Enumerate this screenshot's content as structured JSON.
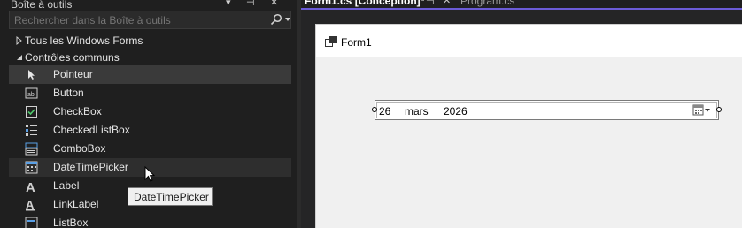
{
  "toolbox": {
    "title": "Boîte à outils",
    "search_placeholder": "Rechercher dans la Boîte à outils",
    "categories": [
      {
        "label": "Tous les Windows Forms",
        "expanded": false
      },
      {
        "label": "Contrôles communs",
        "expanded": true
      }
    ],
    "items": [
      {
        "label": "Pointeur",
        "icon": "pointer-icon"
      },
      {
        "label": "Button",
        "icon": "button-icon"
      },
      {
        "label": "CheckBox",
        "icon": "checkbox-icon"
      },
      {
        "label": "CheckedListBox",
        "icon": "checked-listbox-icon"
      },
      {
        "label": "ComboBox",
        "icon": "combobox-icon"
      },
      {
        "label": "DateTimePicker",
        "icon": "datetimepicker-icon"
      },
      {
        "label": "Label",
        "icon": "label-icon"
      },
      {
        "label": "LinkLabel",
        "icon": "linklabel-icon"
      },
      {
        "label": "ListBox",
        "icon": "listbox-icon"
      }
    ]
  },
  "tabs": [
    {
      "label": "Form1.cs [Conception]*",
      "active": true
    },
    {
      "label": "Program.cs",
      "active": false
    }
  ],
  "designer": {
    "form_title": "Form1",
    "datetimepicker": {
      "day": "26",
      "month": "mars",
      "year": "2026"
    }
  },
  "tooltip": {
    "text": "DateTimePicker"
  },
  "colors": {
    "accent": "#6b5bd6",
    "background": "#1f1f1f",
    "selected_row": "#3a3a3a"
  }
}
